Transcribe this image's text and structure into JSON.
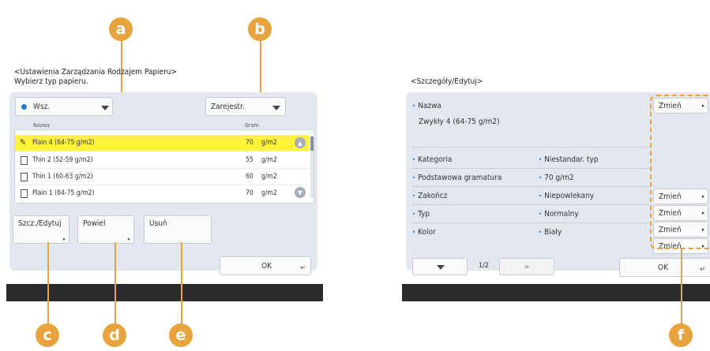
{
  "markers": {
    "a": "a",
    "b": "b",
    "c": "c",
    "d": "d",
    "e": "e",
    "f": "f"
  },
  "left": {
    "breadcrumb": "<Ustawienia Zarządzania Rodzajem Papieru>",
    "instruction": "Wybierz typ papieru.",
    "filter_value": "Wsz.",
    "sort_value": "Zarejestr.",
    "col_name": "Nazwa",
    "col_weight": "Gram.",
    "rows": [
      {
        "name": "Plain 4 (64-75 g/m2)",
        "weight": "70",
        "unit": "g/m2"
      },
      {
        "name": "Thin 2 (52-59 g/m2)",
        "weight": "55",
        "unit": "g/m2"
      },
      {
        "name": "Thin 1 (60-63 g/m2)",
        "weight": "60",
        "unit": "g/m2"
      },
      {
        "name": "Plain 1 (64-75 g/m2)",
        "weight": "70",
        "unit": "g/m2"
      }
    ],
    "btn_details": "Szcz./Edytuj",
    "btn_copy": "Powiel",
    "btn_delete": "Usuń",
    "ok": "OK"
  },
  "right": {
    "title": "<Szczegóły/Edytuj>",
    "name_label": "Nazwa",
    "name_value": "Zwykły 4 (64-75 g/m2)",
    "change": "Zmień",
    "fields": [
      {
        "label": "Kategoria",
        "value": "Niestandar. typ"
      },
      {
        "label": "Podstawowa gramatura",
        "value": "70 g/m2"
      },
      {
        "label": "Zakończ",
        "value": "Niepowlekany"
      },
      {
        "label": "Typ",
        "value": "Normalny"
      },
      {
        "label": "Kolor",
        "value": "Biały"
      }
    ],
    "page": "1/2",
    "ok": "OK"
  }
}
